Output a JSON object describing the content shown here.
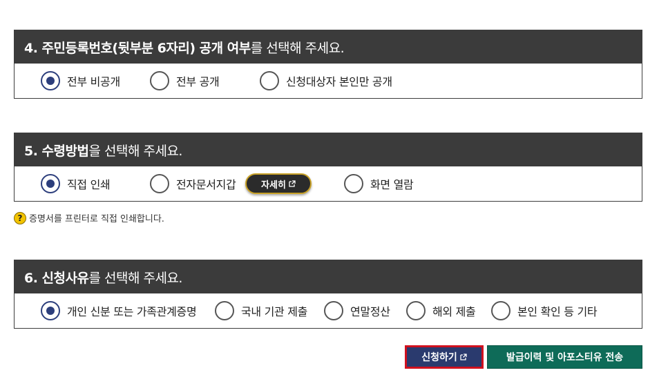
{
  "section4": {
    "title_bold": "4. 주민등록번호(뒷부분 6자리) 공개 여부",
    "title_rest": "를 선택해 주세요.",
    "options": [
      {
        "label": "전부 비공개",
        "selected": true
      },
      {
        "label": "전부 공개",
        "selected": false
      },
      {
        "label": "신청대상자 본인만 공개",
        "selected": false
      }
    ]
  },
  "section5": {
    "title_bold": "5. 수령방법",
    "title_rest": "을 선택해 주세요.",
    "options": [
      {
        "label": "직접 인쇄",
        "selected": true
      },
      {
        "label": "전자문서지갑",
        "selected": false
      },
      {
        "label": "화면 열람",
        "selected": false
      }
    ],
    "detail_button": "자세히",
    "hint_icon": "question-icon",
    "hint_text": "증명서를 프린터로 직접 인쇄합니다."
  },
  "section6": {
    "title_bold": "6. 신청사유",
    "title_rest": "를 선택해 주세요.",
    "options": [
      {
        "label": "개인 신분 또는 가족관계증명",
        "selected": true
      },
      {
        "label": "국내 기관 제출",
        "selected": false
      },
      {
        "label": "연말정산",
        "selected": false
      },
      {
        "label": "해외 제출",
        "selected": false
      },
      {
        "label": "본인 확인 등 기타",
        "selected": false
      }
    ]
  },
  "actions": {
    "apply_label": "신청하기",
    "send_label": "발급이력 및 아포스티유 전송"
  },
  "colors": {
    "header_bg": "#3b3b3b",
    "radio_selected": "#2c3e7c",
    "apply_bg": "#2a3a6e",
    "apply_border": "#d0101e",
    "send_bg": "#0e6b58",
    "detail_border": "#c9a227"
  }
}
